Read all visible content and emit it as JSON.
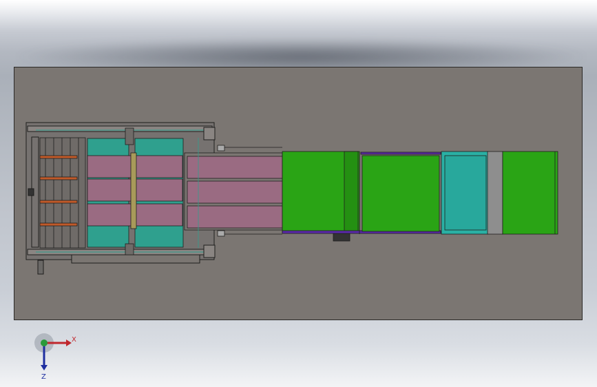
{
  "viewport": {
    "colors": {
      "plate": "#7b7672",
      "plate_edge": "#2a2826",
      "frame_line": "#1e1d1c",
      "teal": "#2fa08e",
      "pink": "#9a6b82",
      "green": "#2aa415",
      "green_light": "#34b81c",
      "cyan": "#2ab0a4",
      "purple": "#5a2aa8",
      "roller": "#8e8e8e",
      "orange": "#c05a2a"
    }
  },
  "triad": {
    "x_label": "X",
    "z_label": "Z",
    "x_color": "#c0272d",
    "y_color": "#2a9a3a",
    "z_color": "#1e2ea0"
  }
}
